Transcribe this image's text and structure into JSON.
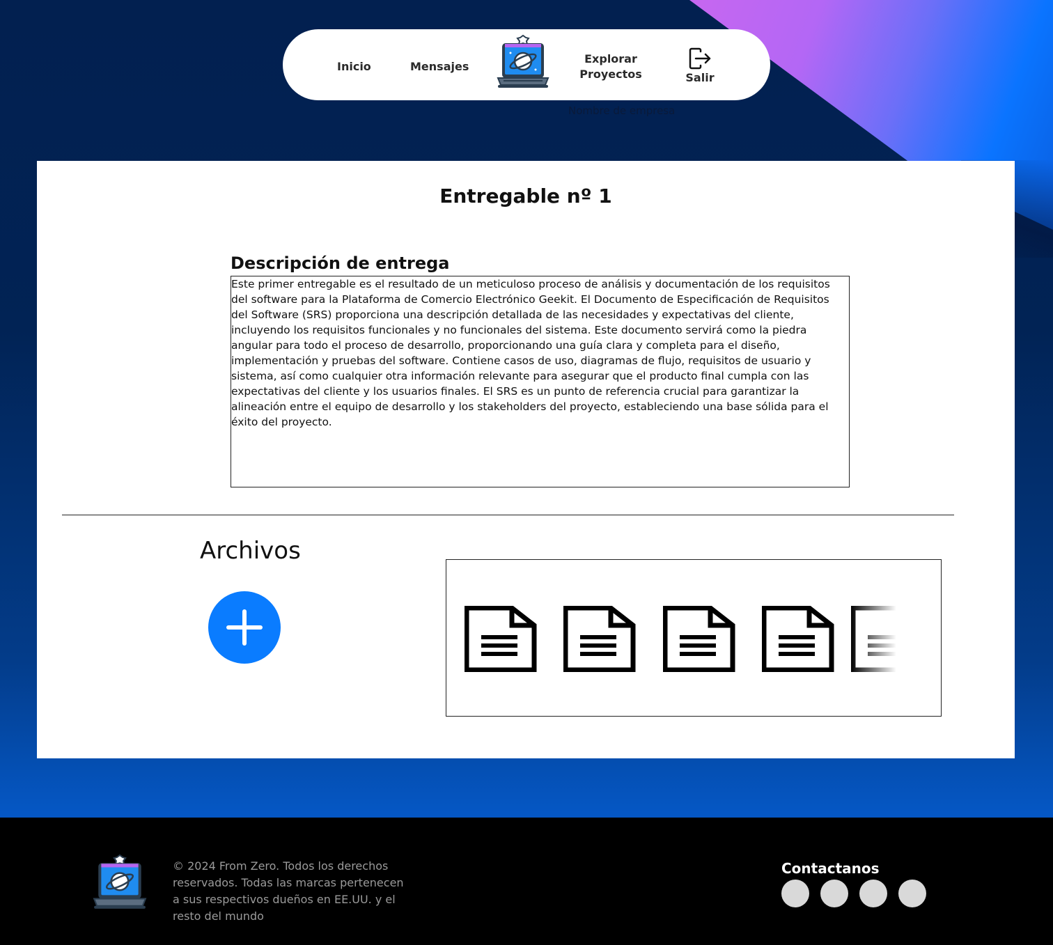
{
  "colors": {
    "background_top": "#022050",
    "background_bottom": "#0557c4",
    "accent_purple": "#b367f5",
    "accent_blue": "#0a74ff",
    "add_button": "#0a7cff",
    "footer_bg": "#000000",
    "footer_text": "#9a9a9a",
    "social_circle": "#d9d9d9"
  },
  "nav": {
    "inicio": "Inicio",
    "mensajes": "Mensajes",
    "logo_icon": "laptop-planet-logo-icon",
    "explorar": "Explorar Proyectos",
    "salir": "Salir",
    "salir_icon": "logout-icon"
  },
  "company_name": "Nombre de empresa",
  "main": {
    "title": "Entregable nº 1",
    "description_label": "Descripción de entrega",
    "description": "Este primer entregable es el resultado de un meticuloso proceso de análisis y documentación de los requisitos del software para la Plataforma de Comercio Electrónico Geekit. El Documento de Especificación de Requisitos del Software (SRS) proporciona una descripción detallada de las necesidades y expectativas del cliente, incluyendo los requisitos funcionales y no funcionales del sistema. Este documento servirá como la piedra angular para todo el proceso de desarrollo, proporcionando una guía clara y completa para el diseño, implementación y pruebas del software. Contiene casos de uso, diagramas de flujo, requisitos de usuario y sistema, así como cualquier otra información relevante para asegurar que el producto final cumpla con las expectativas del cliente y los usuarios finales. El SRS es un punto de referencia crucial para garantizar la alineación entre el equipo de desarrollo y los stakeholders del proyecto, estableciendo una base sólida para el éxito del proyecto.",
    "files_title": "Archivos",
    "add_icon": "plus-circle-icon",
    "file_icon": "document-icon",
    "files_count_visible": 5
  },
  "footer": {
    "logo_icon": "laptop-planet-logo-icon",
    "copyright": "© 2024 From Zero. Todos los derechos reservados. Todas las marcas pertenecen a sus respectivos dueños en EE.UU. y el resto del mundo",
    "contact_title": "Contactanos",
    "social_count": 4
  }
}
